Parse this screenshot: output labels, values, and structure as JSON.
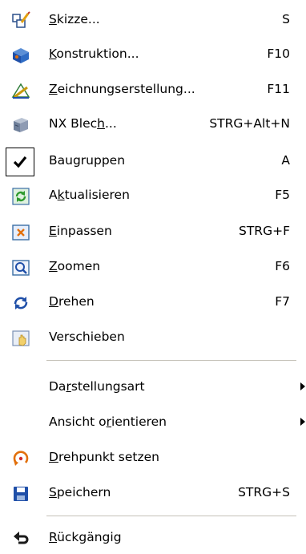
{
  "items": [
    {
      "pre": "",
      "u": "S",
      "post": "kizze...",
      "shortcut": "S",
      "icon": "sketch-icon"
    },
    {
      "pre": "",
      "u": "K",
      "post": "onstruktion...",
      "shortcut": "F10",
      "icon": "modeling-icon"
    },
    {
      "pre": "",
      "u": "Z",
      "post": "eichnungserstellung...",
      "shortcut": "F11",
      "icon": "drafting-icon"
    },
    {
      "pre": "NX Blec",
      "u": "h",
      "post": "...",
      "shortcut": "STRG+Alt+N",
      "icon": "sheet-metal-icon"
    },
    {
      "pre": "Baugruppen",
      "u": "",
      "post": "",
      "shortcut": "A",
      "icon": "checkmark-icon",
      "checked": true
    },
    {
      "pre": "A",
      "u": "k",
      "post": "tualisieren",
      "shortcut": "F5",
      "icon": "refresh-icon"
    },
    {
      "pre": "",
      "u": "E",
      "post": "inpassen",
      "shortcut": "STRG+F",
      "icon": "fit-icon"
    },
    {
      "pre": "",
      "u": "Z",
      "post": "oomen",
      "shortcut": "F6",
      "icon": "zoom-icon"
    },
    {
      "pre": "",
      "u": "D",
      "post": "rehen",
      "shortcut": "F7",
      "icon": "rotate-icon"
    },
    {
      "pre": "Verschieben",
      "u": "",
      "post": "",
      "shortcut": "",
      "icon": "pan-icon"
    },
    {
      "pre": "Da",
      "u": "r",
      "post": "stellungsart",
      "shortcut": "",
      "icon": "",
      "submenu": true
    },
    {
      "pre": "Ansicht o",
      "u": "r",
      "post": "ientieren",
      "shortcut": "",
      "icon": "",
      "submenu": true
    },
    {
      "pre": "",
      "u": "D",
      "post": "rehpunkt setzen",
      "shortcut": "",
      "icon": "pivot-icon"
    },
    {
      "pre": "",
      "u": "S",
      "post": "peichern",
      "shortcut": "STRG+S",
      "icon": "save-icon"
    },
    {
      "pre": "",
      "u": "R",
      "post": "ückgängig",
      "shortcut": "",
      "icon": "undo-icon"
    }
  ],
  "colors": {
    "separator": "#c5c2b8",
    "accent_blue": "#1f5fbf",
    "accent_orange": "#e2700c",
    "accent_green": "#2d9a2d"
  }
}
